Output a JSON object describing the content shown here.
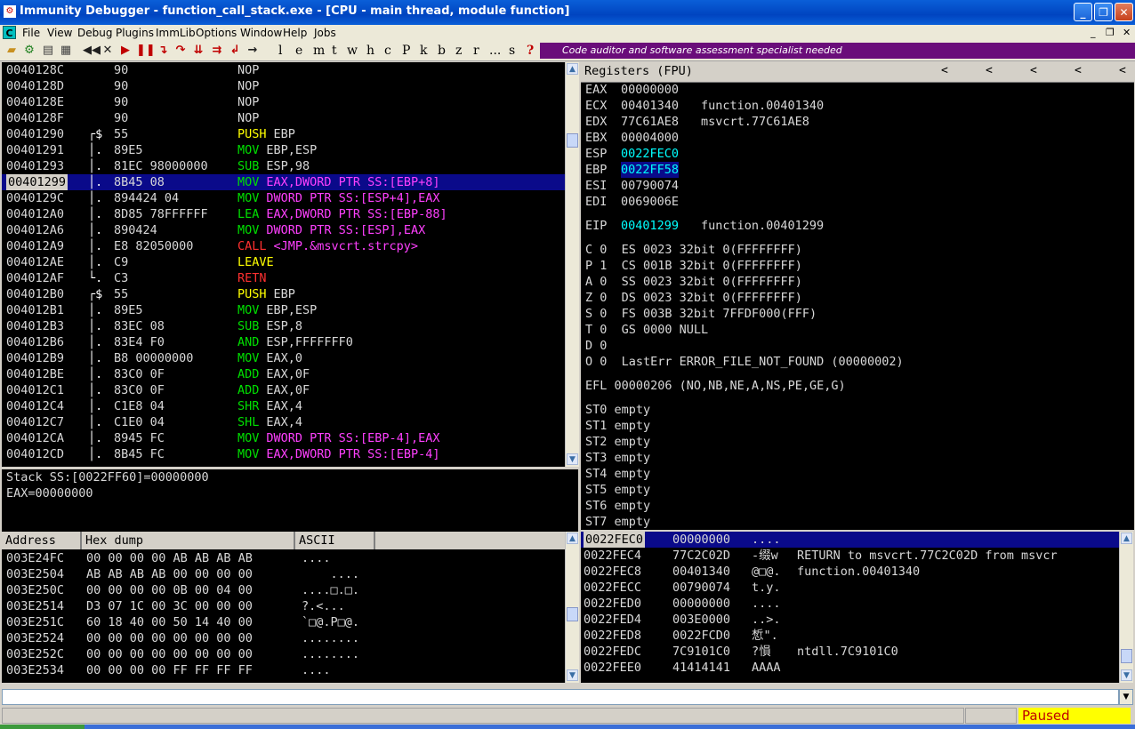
{
  "window": {
    "title": "Immunity Debugger - function_call_stack.exe - [CPU - main thread, module function]",
    "minimize": "_",
    "maximize": "❐",
    "close": "✕"
  },
  "menu": {
    "logo": "C",
    "items": [
      "File",
      "View",
      "Debug",
      "Plugins",
      "ImmLib",
      "Options",
      "Window",
      "Help",
      "Jobs"
    ],
    "mdi_minimize": "_",
    "mdi_restore": "❐",
    "mdi_close": "✕"
  },
  "toolbar": {
    "letters": [
      "l",
      "e",
      "m",
      "t",
      "w",
      "h",
      "c",
      "P",
      "k",
      "b",
      "z",
      "r",
      "...",
      "s",
      "?"
    ],
    "banner": "Code auditor and software assessment specialist needed"
  },
  "colors": {
    "addr": "#d8d8d8",
    "mnemonic_green": "#00e000",
    "mnemonic_yellow": "#ffff00",
    "mnemonic_red": "#ff3030",
    "operand_magenta": "#ff40ff",
    "operand_cyan": "#00ffff",
    "status_bg": "#ffff00",
    "status_fg": "#c00000",
    "selection": "#0a0a8a"
  },
  "disasm": {
    "rows": [
      {
        "addr": "0040128C",
        "mark": "  ",
        "hex": "90",
        "mn": "NOP",
        "op": "",
        "mn_color": "white"
      },
      {
        "addr": "0040128D",
        "mark": "  ",
        "hex": "90",
        "mn": "NOP",
        "op": "",
        "mn_color": "white"
      },
      {
        "addr": "0040128E",
        "mark": "  ",
        "hex": "90",
        "mn": "NOP",
        "op": "",
        "mn_color": "white"
      },
      {
        "addr": "0040128F",
        "mark": "  ",
        "hex": "90",
        "mn": "NOP",
        "op": "",
        "mn_color": "white"
      },
      {
        "addr": "00401290",
        "mark": "┌$",
        "hex": "55",
        "mn": "PUSH",
        "op": "EBP",
        "mn_color": "yellow"
      },
      {
        "addr": "00401291",
        "mark": "│.",
        "hex": "89E5",
        "mn": "MOV",
        "op": "EBP,ESP",
        "mn_color": "green"
      },
      {
        "addr": "00401293",
        "mark": "│.",
        "hex": "81EC 98000000",
        "mn": "SUB",
        "op": "ESP,98",
        "mn_color": "green"
      },
      {
        "addr": "00401299",
        "mark": "│.",
        "hex": "8B45 08",
        "mn": "MOV",
        "op": "EAX,DWORD PTR SS:[EBP+8]",
        "mn_color": "green",
        "selected": true
      },
      {
        "addr": "0040129C",
        "mark": "│.",
        "hex": "894424 04",
        "mn": "MOV",
        "op": "DWORD PTR SS:[ESP+4],EAX",
        "mn_color": "green"
      },
      {
        "addr": "004012A0",
        "mark": "│.",
        "hex": "8D85 78FFFFFF",
        "mn": "LEA",
        "op": "EAX,DWORD PTR SS:[EBP-88]",
        "mn_color": "green"
      },
      {
        "addr": "004012A6",
        "mark": "│.",
        "hex": "890424",
        "mn": "MOV",
        "op": "DWORD PTR SS:[ESP],EAX",
        "mn_color": "green"
      },
      {
        "addr": "004012A9",
        "mark": "│.",
        "hex": "E8 82050000",
        "mn": "CALL",
        "op": "<JMP.&msvcrt.strcpy>",
        "mn_color": "red"
      },
      {
        "addr": "004012AE",
        "mark": "│.",
        "hex": "C9",
        "mn": "LEAVE",
        "op": "",
        "mn_color": "yellow"
      },
      {
        "addr": "004012AF",
        "mark": "└.",
        "hex": "C3",
        "mn": "RETN",
        "op": "",
        "mn_color": "red"
      },
      {
        "addr": "004012B0",
        "mark": "┌$",
        "hex": "55",
        "mn": "PUSH",
        "op": "EBP",
        "mn_color": "yellow"
      },
      {
        "addr": "004012B1",
        "mark": "│.",
        "hex": "89E5",
        "mn": "MOV",
        "op": "EBP,ESP",
        "mn_color": "green"
      },
      {
        "addr": "004012B3",
        "mark": "│.",
        "hex": "83EC 08",
        "mn": "SUB",
        "op": "ESP,8",
        "mn_color": "green"
      },
      {
        "addr": "004012B6",
        "mark": "│.",
        "hex": "83E4 F0",
        "mn": "AND",
        "op": "ESP,FFFFFFF0",
        "mn_color": "green"
      },
      {
        "addr": "004012B9",
        "mark": "│.",
        "hex": "B8 00000000",
        "mn": "MOV",
        "op": "EAX,0",
        "mn_color": "green"
      },
      {
        "addr": "004012BE",
        "mark": "│.",
        "hex": "83C0 0F",
        "mn": "ADD",
        "op": "EAX,0F",
        "mn_color": "green"
      },
      {
        "addr": "004012C1",
        "mark": "│.",
        "hex": "83C0 0F",
        "mn": "ADD",
        "op": "EAX,0F",
        "mn_color": "green"
      },
      {
        "addr": "004012C4",
        "mark": "│.",
        "hex": "C1E8 04",
        "mn": "SHR",
        "op": "EAX,4",
        "mn_color": "green"
      },
      {
        "addr": "004012C7",
        "mark": "│.",
        "hex": "C1E0 04",
        "mn": "SHL",
        "op": "EAX,4",
        "mn_color": "green"
      },
      {
        "addr": "004012CA",
        "mark": "│.",
        "hex": "8945 FC",
        "mn": "MOV",
        "op": "DWORD PTR SS:[EBP-4],EAX",
        "mn_color": "green"
      },
      {
        "addr": "004012CD",
        "mark": "│.",
        "hex": "8B45 FC",
        "mn": "MOV",
        "op": "EAX,DWORD PTR SS:[EBP-4]",
        "mn_color": "green"
      }
    ]
  },
  "info": {
    "line1": "Stack SS:[0022FF60]=00000000",
    "line2": "EAX=00000000"
  },
  "registers": {
    "header": "Registers (FPU)",
    "arrows": [
      "<",
      "<",
      "<",
      "<",
      "<"
    ],
    "gp": [
      {
        "name": "EAX",
        "value": "00000000",
        "comment": "",
        "changed": false
      },
      {
        "name": "ECX",
        "value": "00401340",
        "comment": "function.00401340",
        "changed": false
      },
      {
        "name": "EDX",
        "value": "77C61AE8",
        "comment": "msvcrt.77C61AE8",
        "changed": false
      },
      {
        "name": "EBX",
        "value": "00004000",
        "comment": "",
        "changed": false
      },
      {
        "name": "ESP",
        "value": "0022FEC0",
        "comment": "",
        "changed": true
      },
      {
        "name": "EBP",
        "value": "0022FF58",
        "comment": "",
        "changed": true,
        "selected": true
      },
      {
        "name": "ESI",
        "value": "00790074",
        "comment": "",
        "changed": false
      },
      {
        "name": "EDI",
        "value": "0069006E",
        "comment": "",
        "changed": false
      }
    ],
    "eip": {
      "name": "EIP",
      "value": "00401299",
      "comment": "function.00401299"
    },
    "flags": [
      "C 0  ES 0023 32bit 0(FFFFFFFF)",
      "P 1  CS 001B 32bit 0(FFFFFFFF)",
      "A 0  SS 0023 32bit 0(FFFFFFFF)",
      "Z 0  DS 0023 32bit 0(FFFFFFFF)",
      "S 0  FS 003B 32bit 7FFDF000(FFF)",
      "T 0  GS 0000 NULL",
      "D 0",
      "O 0  LastErr ERROR_FILE_NOT_FOUND (00000002)"
    ],
    "efl": "EFL 00000206 (NO,NB,NE,A,NS,PE,GE,G)",
    "fpu": [
      "ST0 empty",
      "ST1 empty",
      "ST2 empty",
      "ST3 empty",
      "ST4 empty",
      "ST5 empty",
      "ST6 empty",
      "ST7 empty"
    ]
  },
  "dump": {
    "headers": [
      "Address",
      "Hex dump",
      "ASCII"
    ],
    "rows": [
      {
        "addr": "003E24FC",
        "hex": "00 00 00 00 AB AB AB AB",
        "ascii": "...."
      },
      {
        "addr": "003E2504",
        "hex": "AB AB AB AB 00 00 00 00",
        "ascii": "    ...."
      },
      {
        "addr": "003E250C",
        "hex": "00 00 00 00 0B 00 04 00",
        "ascii": "....□.□."
      },
      {
        "addr": "003E2514",
        "hex": "D3 07 1C 00 3C 00 00 00",
        "ascii": "?.<..."
      },
      {
        "addr": "003E251C",
        "hex": "60 18 40 00 50 14 40 00",
        "ascii": "`□@.P□@."
      },
      {
        "addr": "003E2524",
        "hex": "00 00 00 00 00 00 00 00",
        "ascii": "........"
      },
      {
        "addr": "003E252C",
        "hex": "00 00 00 00 00 00 00 00",
        "ascii": "........"
      },
      {
        "addr": "003E2534",
        "hex": "00 00 00 00 FF FF FF FF",
        "ascii": "...."
      }
    ]
  },
  "stack": {
    "rows": [
      {
        "addr": "0022FEC0",
        "value": "00000000",
        "ascii": "....",
        "comment": "",
        "selected": true
      },
      {
        "addr": "0022FEC4",
        "value": "77C2C02D",
        "ascii": "-缀w",
        "comment": "RETURN to msvcrt.77C2C02D from msvcr"
      },
      {
        "addr": "0022FEC8",
        "value": "00401340",
        "ascii": "@□@.",
        "comment": "function.00401340"
      },
      {
        "addr": "0022FECC",
        "value": "00790074",
        "ascii": "t.y.",
        "comment": ""
      },
      {
        "addr": "0022FED0",
        "value": "00000000",
        "ascii": "....",
        "comment": ""
      },
      {
        "addr": "0022FED4",
        "value": "003E0000",
        "ascii": "..>.",
        "comment": ""
      },
      {
        "addr": "0022FED8",
        "value": "0022FCD0",
        "ascii": "惁\".",
        "comment": ""
      },
      {
        "addr": "0022FEDC",
        "value": "7C9101C0",
        "ascii": "?愪",
        "comment": "ntdll.7C9101C0"
      },
      {
        "addr": "0022FEE0",
        "value": "41414141",
        "ascii": "AAAA",
        "comment": ""
      }
    ]
  },
  "status": {
    "text": "Paused"
  }
}
